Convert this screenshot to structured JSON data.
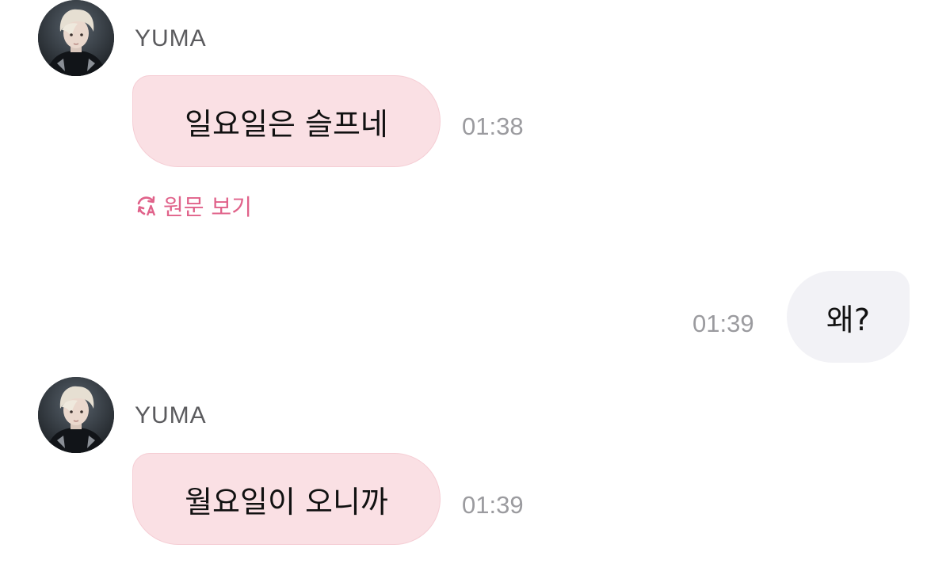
{
  "colors": {
    "accent": "#e0628a",
    "incoming_bubble": "#fae0e4",
    "outgoing_bubble": "#f2f2f6",
    "timestamp": "#9b9b9f",
    "sender_name": "#5b5b5e"
  },
  "messages": [
    {
      "direction": "incoming",
      "sender": "YUMA",
      "avatar_icon": "profile-photo",
      "text": "일요일은 슬프네",
      "time": "01:38",
      "translate_icon": "translate-icon",
      "translate_label": "원문 보기"
    },
    {
      "direction": "outgoing",
      "text": "왜?",
      "time": "01:39"
    },
    {
      "direction": "incoming",
      "sender": "YUMA",
      "avatar_icon": "profile-photo",
      "text": "월요일이 오니까",
      "time": "01:39"
    }
  ]
}
